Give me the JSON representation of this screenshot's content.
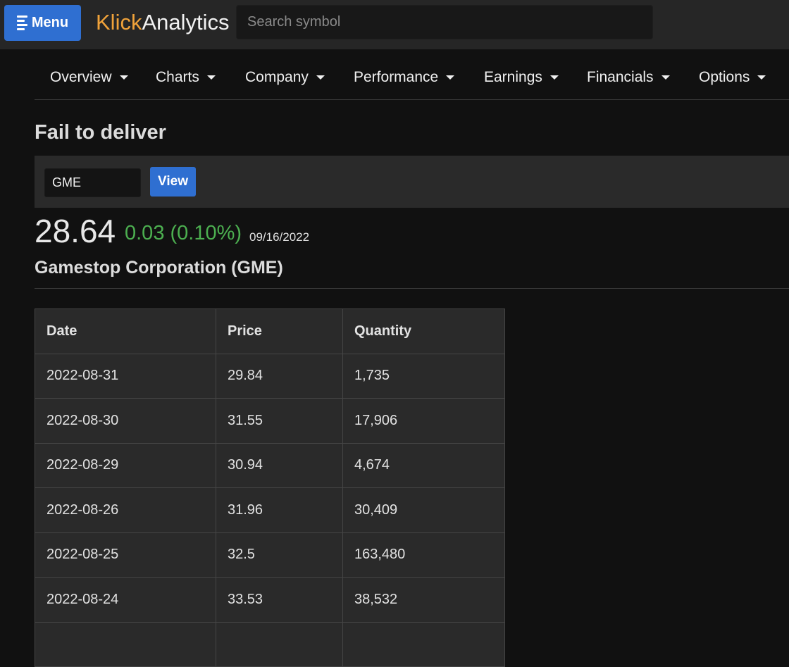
{
  "header": {
    "menu_label": "Menu",
    "brand_part1": "Klick",
    "brand_part2": "Analytics",
    "search_placeholder": "Search symbol"
  },
  "nav": {
    "items": [
      {
        "label": "Overview"
      },
      {
        "label": "Charts"
      },
      {
        "label": "Company"
      },
      {
        "label": "Performance"
      },
      {
        "label": "Earnings"
      },
      {
        "label": "Financials"
      },
      {
        "label": "Options"
      }
    ]
  },
  "page": {
    "title": "Fail to deliver",
    "symbol_value": "GME",
    "view_label": "View"
  },
  "quote": {
    "price": "28.64",
    "change": "0.03 (0.10%)",
    "date": "09/16/2022",
    "company": "Gamestop Corporation (GME)"
  },
  "table": {
    "headers": [
      "Date",
      "Price",
      "Quantity"
    ],
    "rows": [
      [
        "2022-08-31",
        "29.84",
        "1,735"
      ],
      [
        "2022-08-30",
        "31.55",
        "17,906"
      ],
      [
        "2022-08-29",
        "30.94",
        "4,674"
      ],
      [
        "2022-08-26",
        "31.96",
        "30,409"
      ],
      [
        "2022-08-25",
        "32.5",
        "163,480"
      ],
      [
        "2022-08-24",
        "33.53",
        "38,532"
      ],
      [
        "",
        "",
        ""
      ]
    ]
  },
  "colors": {
    "accent": "#2f6fd1",
    "brand_orange": "#f0a23a",
    "positive": "#4caf50",
    "background": "#111111"
  }
}
